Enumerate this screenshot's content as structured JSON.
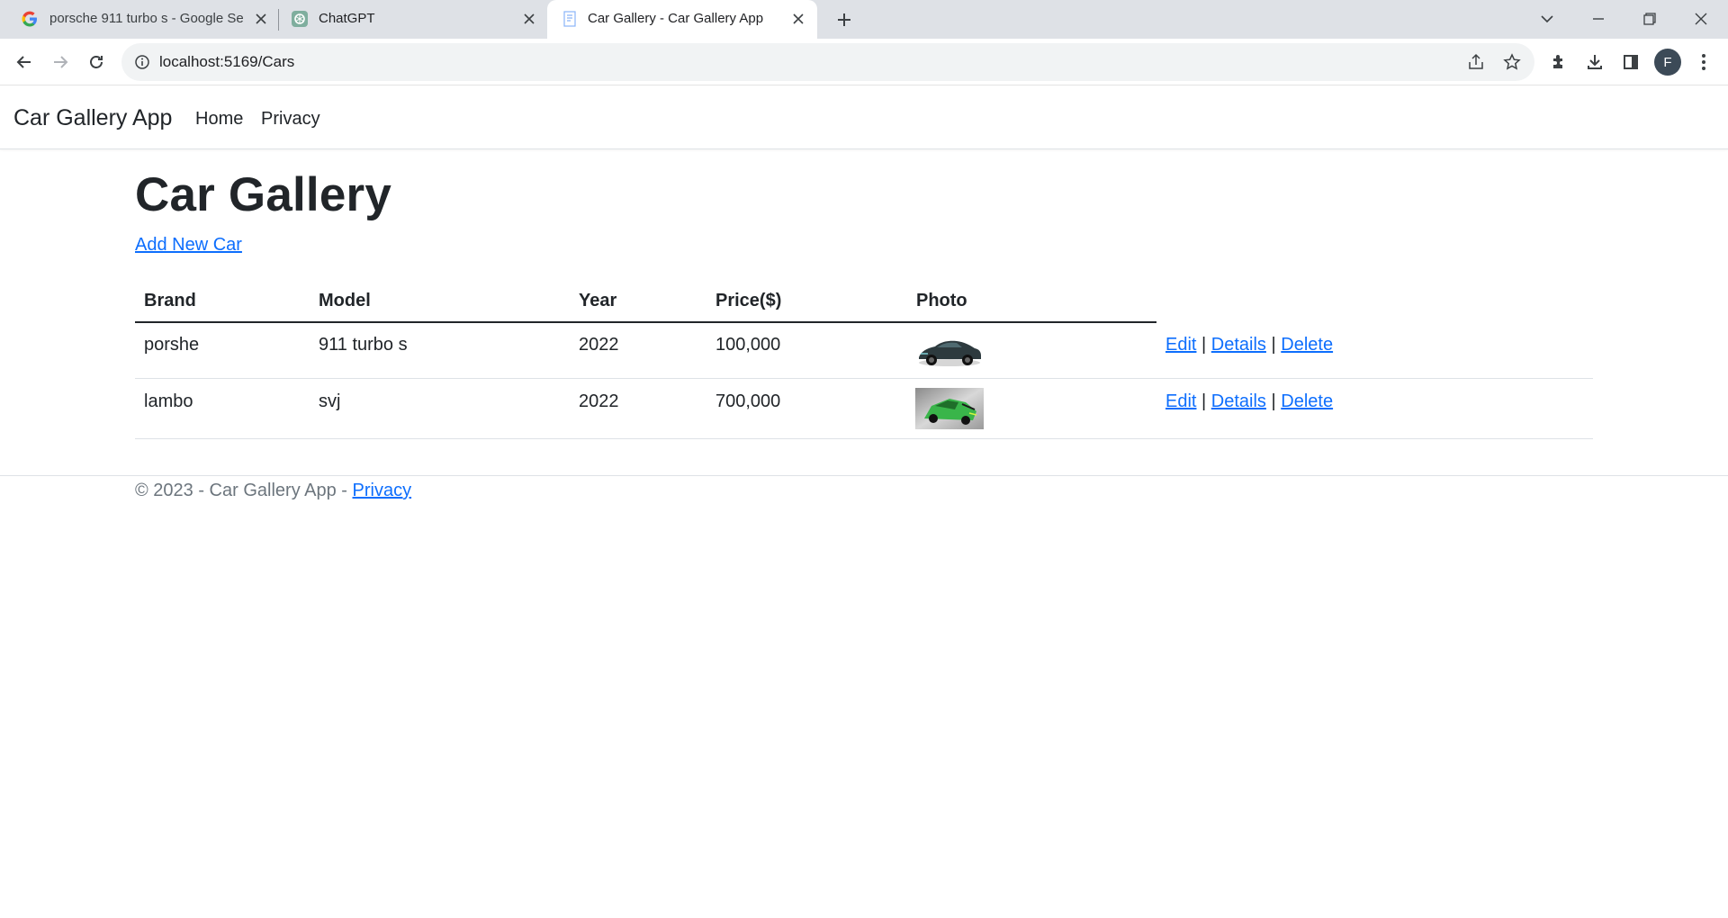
{
  "browser": {
    "tabs": [
      {
        "title": "porsche 911 turbo s - Google Se",
        "icon": "google-icon"
      },
      {
        "title": "ChatGPT",
        "icon": "chatgpt-icon"
      },
      {
        "title": "Car Gallery - Car Gallery App",
        "icon": "page-icon"
      }
    ],
    "url": "localhost:5169/Cars",
    "profile_initial": "F"
  },
  "app": {
    "brand": "Car Gallery App",
    "nav": [
      "Home",
      "Privacy"
    ]
  },
  "page": {
    "title": "Car Gallery",
    "add_link": "Add New Car",
    "columns": [
      "Brand",
      "Model",
      "Year",
      "Price($)",
      "Photo"
    ],
    "cars": [
      {
        "brand": "porshe",
        "model": "911 turbo s",
        "year": "2022",
        "price": "100,000",
        "photo_color": "#2d3a3e"
      },
      {
        "brand": "lambo",
        "model": "svj",
        "year": "2022",
        "price": "700,000",
        "photo_color": "#39b54a"
      }
    ],
    "actions": {
      "edit": "Edit",
      "details": "Details",
      "delete": "Delete",
      "separator": "|"
    }
  },
  "footer": {
    "text": "© 2023 - Car Gallery App - ",
    "privacy": "Privacy"
  },
  "colors": {
    "link": "#0d6efd",
    "tabstrip": "#dee1e6"
  }
}
